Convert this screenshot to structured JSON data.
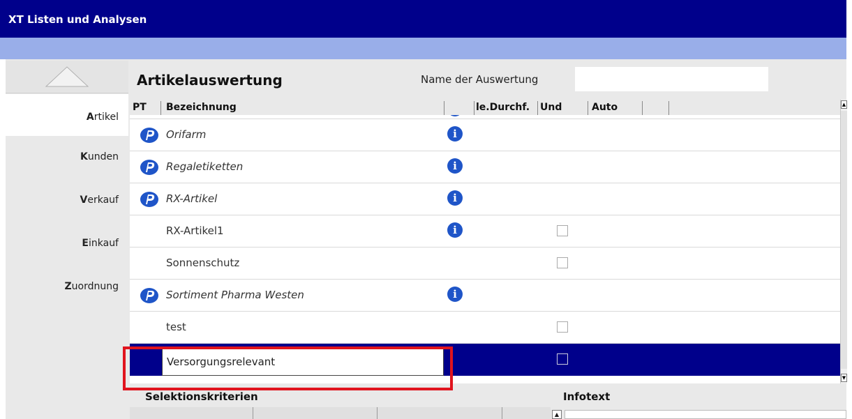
{
  "window": {
    "title": "XT Listen und Analysen"
  },
  "sidebar": {
    "items": [
      {
        "key": "A",
        "rest": "rtikel",
        "active": true
      },
      {
        "key": "K",
        "rest": "unden",
        "active": false
      },
      {
        "key": "V",
        "rest": "erkauf",
        "active": false
      },
      {
        "key": "E",
        "rest": "inkauf",
        "active": false
      },
      {
        "key": "Z",
        "rest": "uordnung",
        "active": false
      }
    ]
  },
  "header": {
    "title": "Artikelauswertung",
    "name_label": "Name der Auswertung",
    "name_value": ""
  },
  "columns": {
    "pt": "PT",
    "bezeichnung": "Bezeichnung",
    "durchf": "le.Durchf.",
    "und": "Und",
    "auto": "Auto"
  },
  "rows": [
    {
      "label": "Orifarm",
      "icon": "p-icon",
      "info": true,
      "checkbox": false,
      "italic": true
    },
    {
      "label": "Regaletiketten",
      "icon": "p-icon",
      "info": true,
      "checkbox": false,
      "italic": true
    },
    {
      "label": "RX-Artikel",
      "icon": "p-icon",
      "info": true,
      "checkbox": false,
      "italic": true
    },
    {
      "label": "RX-Artikel1",
      "icon": "",
      "info": true,
      "checkbox": true,
      "italic": false
    },
    {
      "label": "Sonnenschutz",
      "icon": "",
      "info": false,
      "checkbox": true,
      "italic": false
    },
    {
      "label": "Sortiment Pharma Westen",
      "icon": "p-icon",
      "info": true,
      "checkbox": false,
      "italic": true
    },
    {
      "label": "test",
      "icon": "",
      "info": false,
      "checkbox": true,
      "italic": false
    },
    {
      "label": "Versorgungsrelevant",
      "icon": "",
      "info": false,
      "checkbox": true,
      "italic": false,
      "selected": true,
      "editing": true
    }
  ],
  "info_glyph": "i",
  "bottom": {
    "selection_label": "Selektionskriterien",
    "infotext_label": "Infotext"
  },
  "colors": {
    "titlebar": "#00008b",
    "subbar": "#99aee9",
    "selected_row": "#00008b",
    "highlight": "#e0141e",
    "info_icon": "#1f55c8"
  }
}
